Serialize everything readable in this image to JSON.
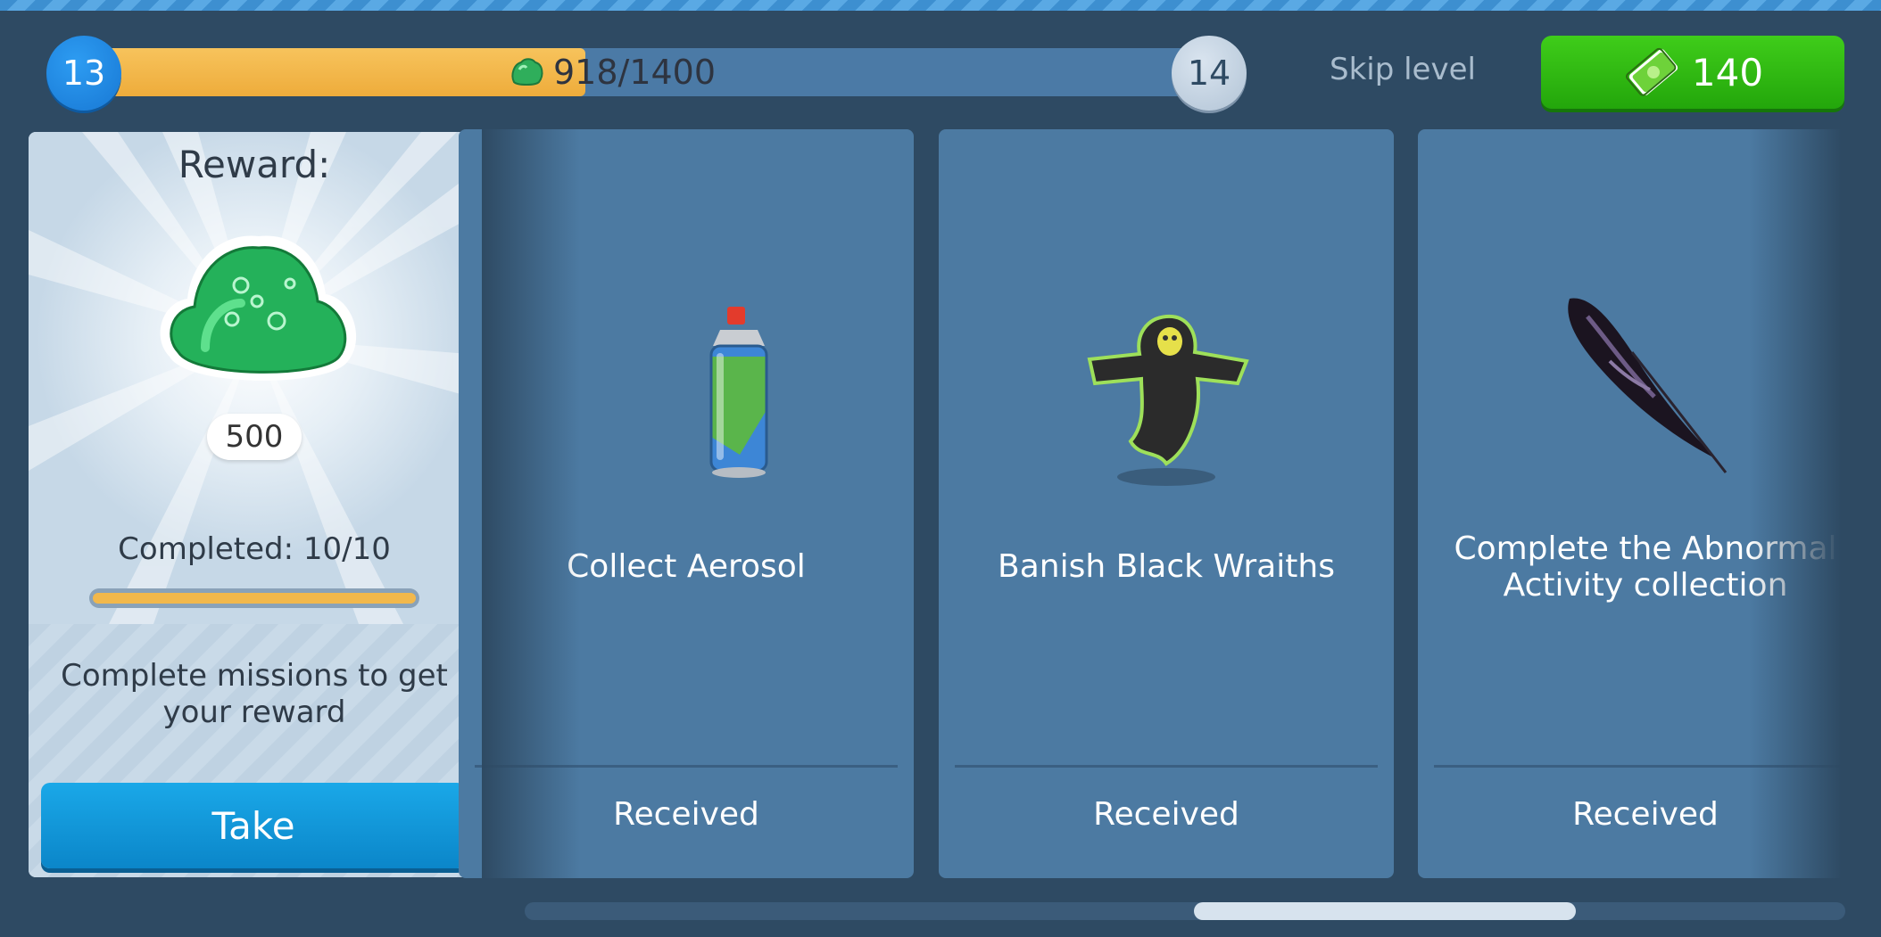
{
  "level": {
    "current": "13",
    "next": "14",
    "progress_text": "918/1400",
    "progress_fraction": 0.6557,
    "currency_icon": "green-gem-icon"
  },
  "skip": {
    "label": "Skip level",
    "price": "140",
    "icon": "cash-icon"
  },
  "reward": {
    "title": "Reward:",
    "item_icon": "slime-gem-icon",
    "amount": "500",
    "completed_text": "Completed: 10/10",
    "completed_fraction": 1.0,
    "hint": "Complete missions to get your reward",
    "take_label": "Take"
  },
  "missions": [
    {
      "title": "Collect Aerosol",
      "status": "Received",
      "icon": "aerosol-can-icon"
    },
    {
      "title": "Banish Black Wraiths",
      "status": "Received",
      "icon": "black-wraith-icon"
    },
    {
      "title": "Complete the Abnormal Activity collection",
      "status": "Received",
      "icon": "black-feather-icon"
    }
  ],
  "colors": {
    "background": "#2e4a63",
    "card": "#4c7aa2",
    "progress": "#f2b84b",
    "skip_button": "#2fb812",
    "take_button": "#0f96d6"
  }
}
